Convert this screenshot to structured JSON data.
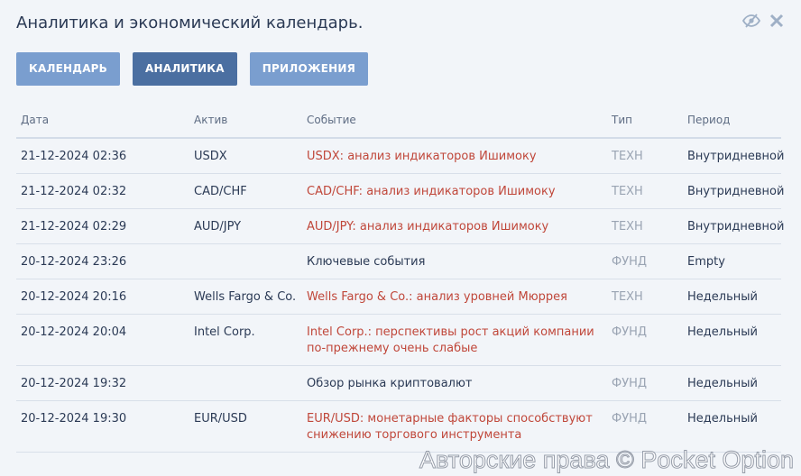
{
  "header": {
    "title": "Аналитика и экономический календарь.",
    "icons": [
      "eye-slash-icon",
      "close-icon"
    ]
  },
  "tabs": [
    {
      "label": "КАЛЕНДАРЬ",
      "active": false
    },
    {
      "label": "АНАЛИТИКА",
      "active": true
    },
    {
      "label": "ПРИЛОЖЕНИЯ",
      "active": false
    }
  ],
  "table": {
    "columns": [
      "Дата",
      "Актив",
      "Событие",
      "Тип",
      "Период"
    ],
    "rows": [
      {
        "date": "21-12-2024 02:36",
        "asset": "USDX",
        "event": "USDX: анализ индикаторов Ишимоку",
        "event_link": true,
        "type": "ТЕХН",
        "period": "Внутридневной"
      },
      {
        "date": "21-12-2024 02:32",
        "asset": "CAD/CHF",
        "event": "CAD/CHF: анализ индикаторов Ишимоку",
        "event_link": true,
        "type": "ТЕХН",
        "period": "Внутридневной"
      },
      {
        "date": "21-12-2024 02:29",
        "asset": "AUD/JPY",
        "event": "AUD/JPY: анализ индикаторов Ишимоку",
        "event_link": true,
        "type": "ТЕХН",
        "period": "Внутридневной"
      },
      {
        "date": "20-12-2024 23:26",
        "asset": "",
        "event": "Ключевые события",
        "event_link": false,
        "type": "ФУНД",
        "period": "Empty"
      },
      {
        "date": "20-12-2024 20:16",
        "asset": "Wells Fargo & Co.",
        "event": "Wells Fargo & Co.: анализ уровней Мюррея",
        "event_link": true,
        "type": "ТЕХН",
        "period": "Недельный"
      },
      {
        "date": "20-12-2024 20:04",
        "asset": "Intel Corp.",
        "event": "Intel Corp.: перспективы рост акций компании по-прежнему очень слабые",
        "event_link": true,
        "type": "ФУНД",
        "period": "Недельный"
      },
      {
        "date": "20-12-2024 19:32",
        "asset": "",
        "event": "Обзор рынка криптовалют",
        "event_link": false,
        "type": "ФУНД",
        "period": "Недельный"
      },
      {
        "date": "20-12-2024 19:30",
        "asset": "EUR/USD",
        "event": "EUR/USD: монетарные факторы способствуют снижению торгового инструмента",
        "event_link": true,
        "type": "ФУНД",
        "period": "Недельный"
      }
    ]
  },
  "watermark": "Авторские права © Pocket Option",
  "colors": {
    "background": "#f2f5f9",
    "tab": "#7a9ecf",
    "tab_active": "#4b6fa1",
    "link": "#c0473a",
    "muted": "#9aa4b3",
    "text": "#2b3a55"
  }
}
